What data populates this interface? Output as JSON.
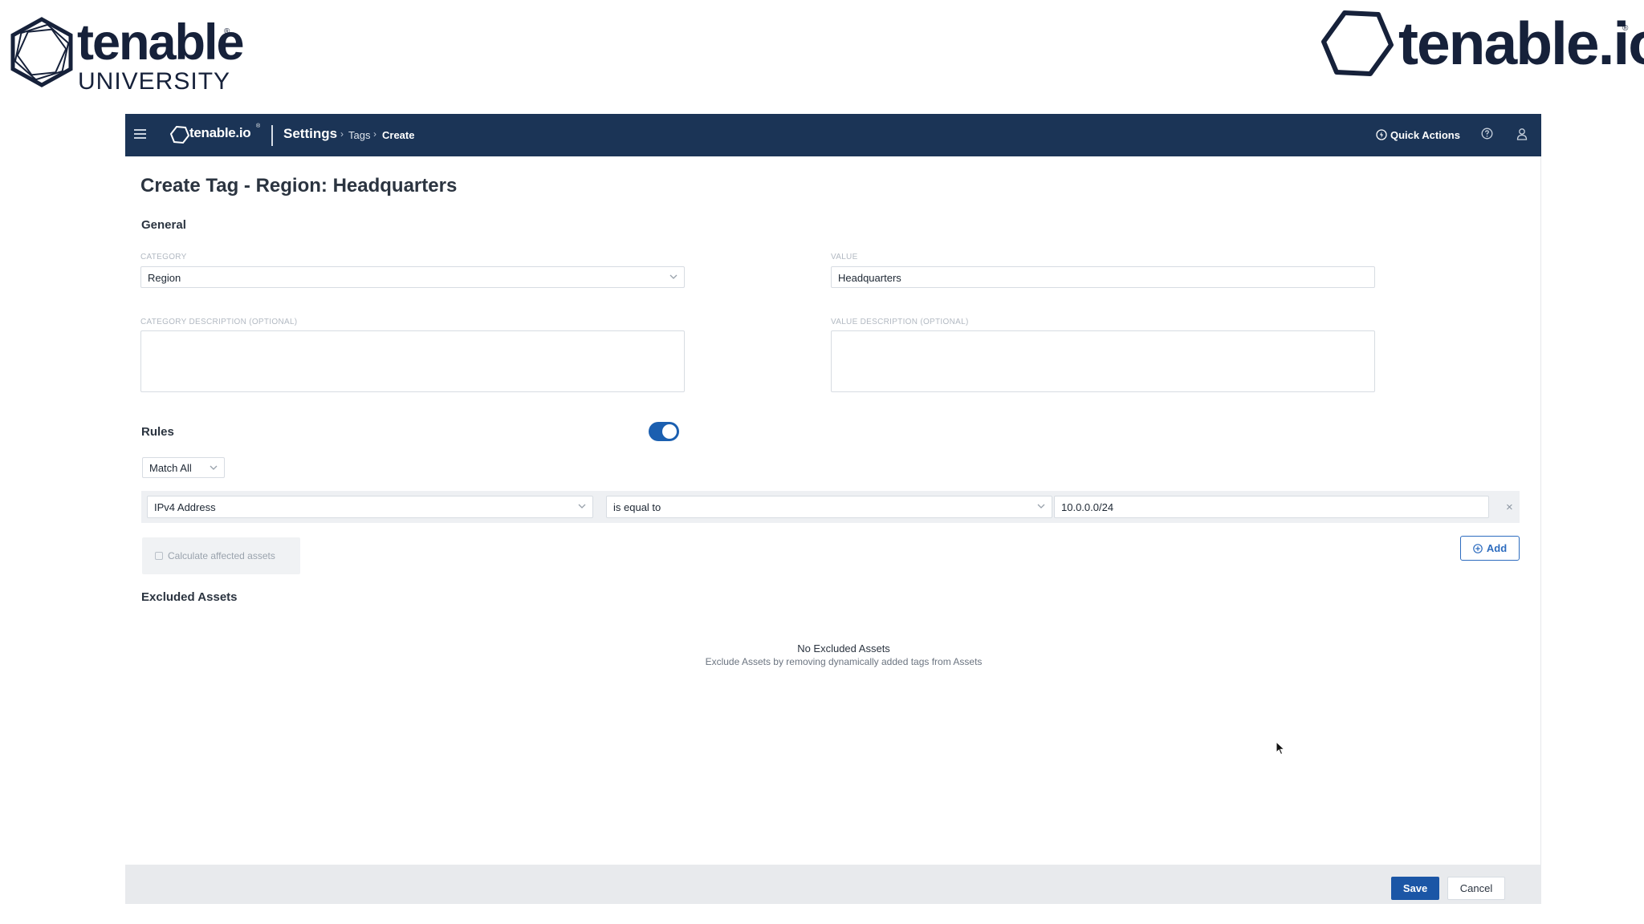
{
  "branding": {
    "left_word": "tenable",
    "left_sub": "UNIVERSITY",
    "left_reg": "®",
    "right_word": "tenable.io",
    "right_reg": "®"
  },
  "topbar": {
    "logo_text": "tenable.io",
    "logo_reg": "®",
    "breadcrumb": {
      "root": "Settings",
      "sep": "›",
      "tags": "Tags",
      "current": "Create"
    },
    "quick_actions": "Quick Actions"
  },
  "page": {
    "title": "Create Tag - Region: Headquarters",
    "general_label": "General"
  },
  "form": {
    "category_label": "CATEGORY",
    "category_value": "Region",
    "value_label": "VALUE",
    "value_value": "Headquarters",
    "category_desc_label": "CATEGORY DESCRIPTION (OPTIONAL)",
    "value_desc_label": "VALUE DESCRIPTION (OPTIONAL)"
  },
  "rules": {
    "title": "Rules",
    "toggle_on": true,
    "match": "Match All",
    "rule": {
      "field": "IPv4 Address",
      "operator": "is equal to",
      "value": "10.0.0.0/24",
      "remove": "×"
    },
    "calculate": "Calculate affected assets",
    "add": "Add"
  },
  "excluded": {
    "title": "Excluded Assets",
    "empty_title": "No Excluded Assets",
    "empty_sub": "Exclude Assets by removing dynamically added tags from Assets"
  },
  "footer": {
    "save": "Save",
    "cancel": "Cancel"
  },
  "colors": {
    "navbar": "#1b3456",
    "primary": "#1b56a6",
    "toggle": "#1b5fb0"
  }
}
